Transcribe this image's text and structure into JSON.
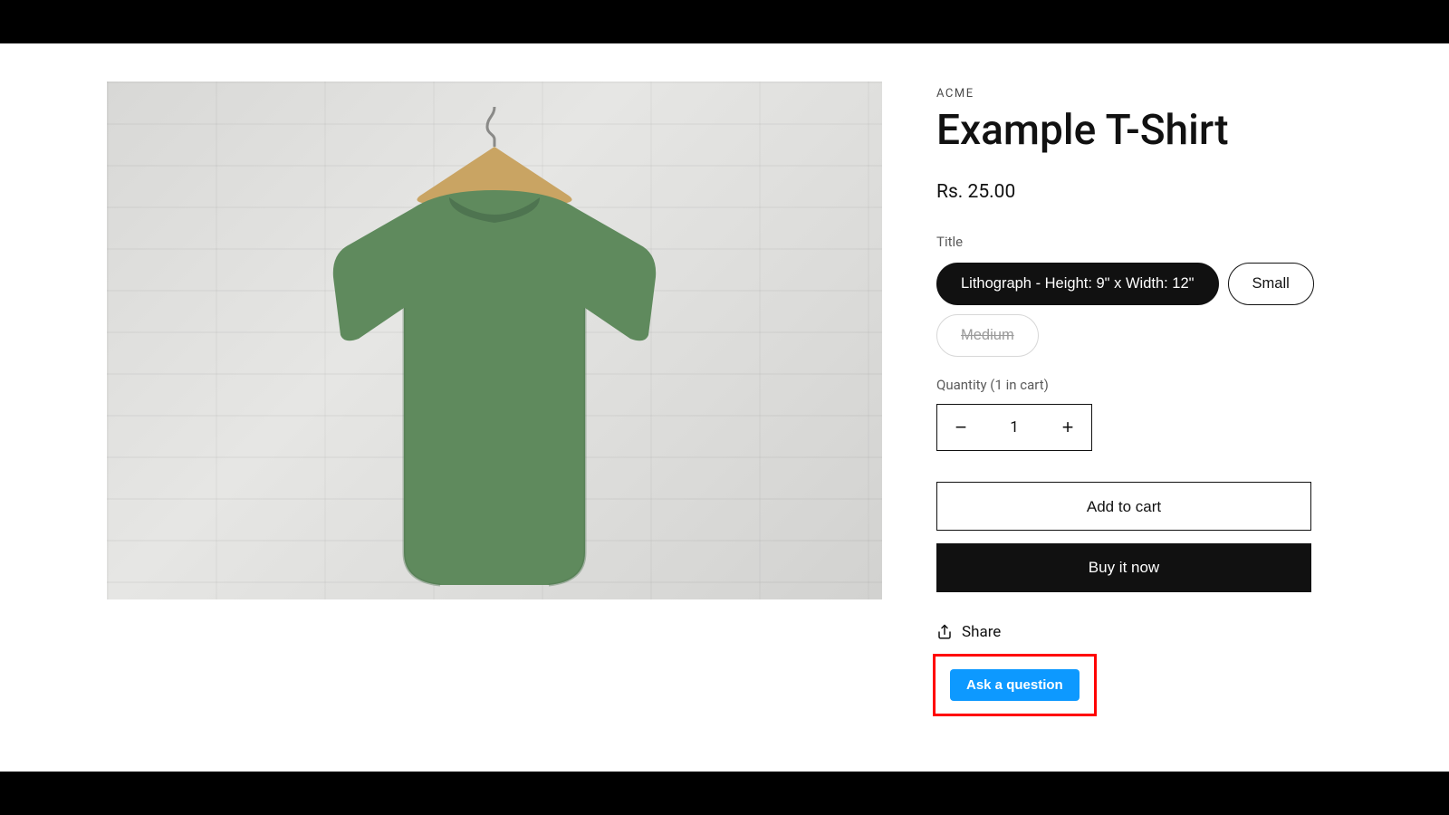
{
  "brand": "ACME",
  "title": "Example T-Shirt",
  "price": "Rs. 25.00",
  "option_label": "Title",
  "variants": {
    "selected": "Lithograph - Height: 9\" x Width: 12\"",
    "available": "Small",
    "unavailable": "Medium"
  },
  "quantity_label": "Quantity (1 in cart)",
  "quantity_value": "1",
  "add_to_cart": "Add to cart",
  "buy_now": "Buy it now",
  "share": "Share",
  "ask": "Ask a question"
}
